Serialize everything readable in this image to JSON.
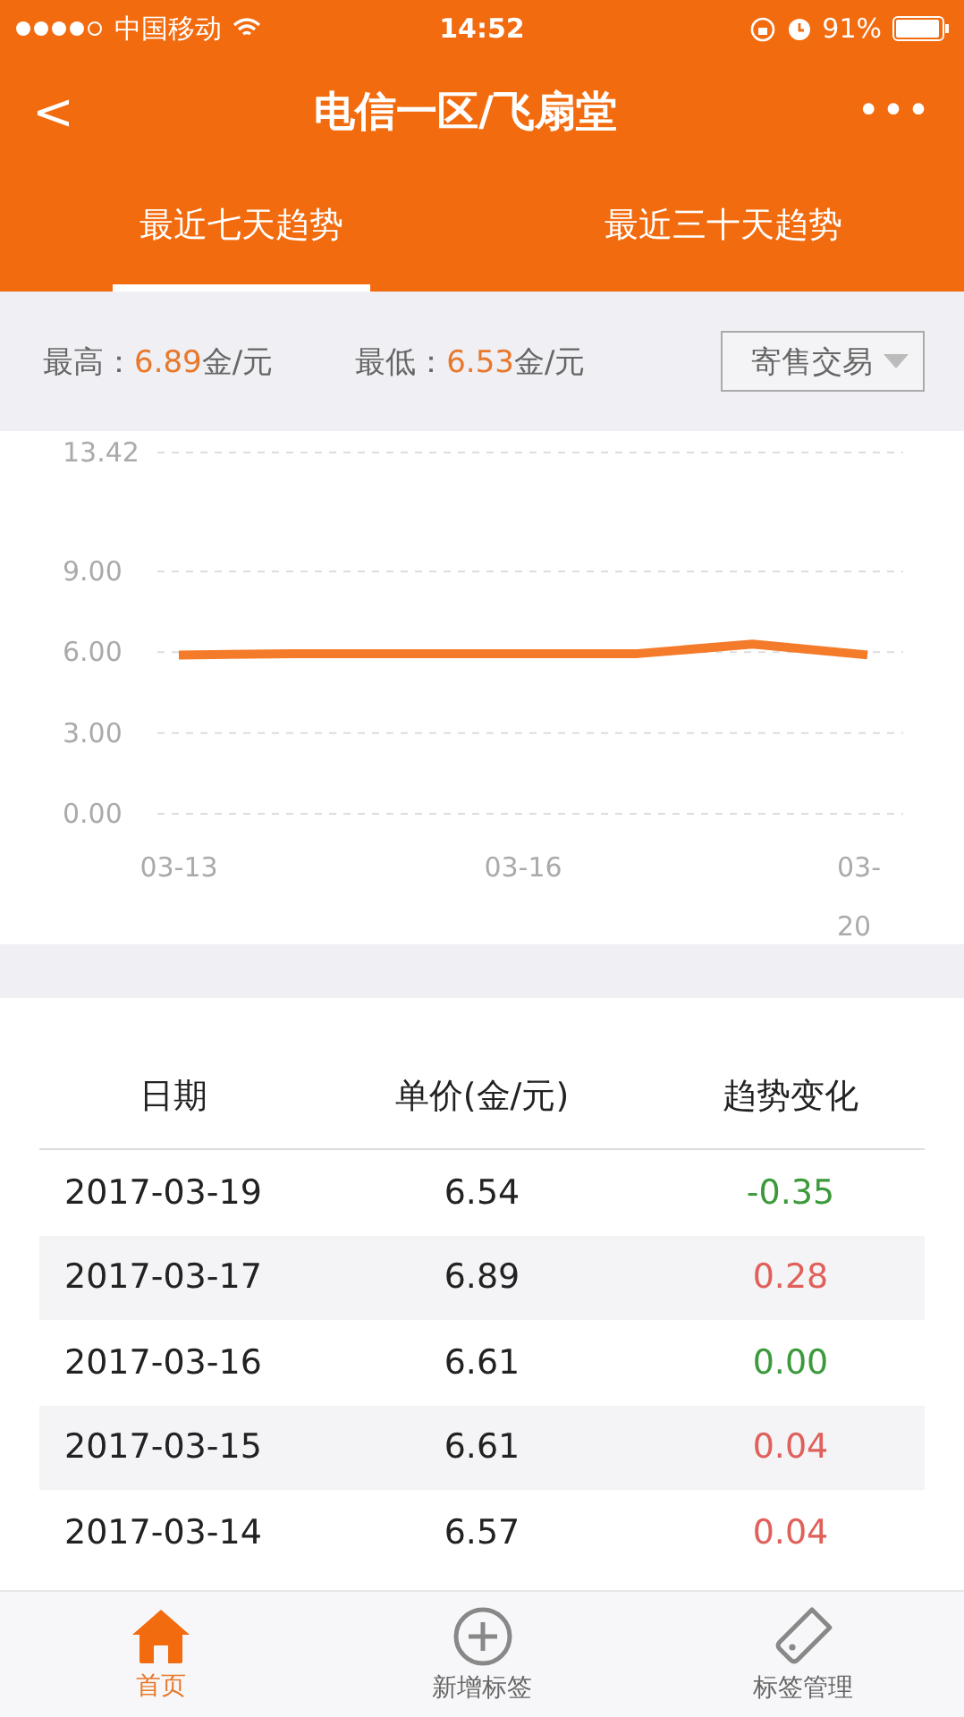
{
  "status_bar": {
    "carrier": "中国移动",
    "time": "14:52",
    "battery": "91%"
  },
  "header": {
    "back": "<",
    "title": "电信一区/飞扇堂",
    "more": "•••"
  },
  "tabs": [
    {
      "label": "最近七天趋势",
      "selected": true
    },
    {
      "label": "最近三十天趋势",
      "selected": false
    }
  ],
  "summary": {
    "high_label": "最高：",
    "high_value": "6.89",
    "high_unit": "金/元",
    "low_label": "最低：",
    "low_value": "6.53",
    "low_unit": "金/元",
    "dropdown": "寄售交易"
  },
  "chart_data": {
    "type": "line",
    "grid": true,
    "categories": [
      "03-13",
      null,
      null,
      "03-16",
      null,
      null,
      "03-20"
    ],
    "ylim": [
      0,
      13.42
    ],
    "yticks": [
      {
        "value": 0,
        "label": "0.00"
      },
      {
        "value": 3,
        "label": "3.00"
      },
      {
        "value": 6,
        "label": "6.00"
      },
      {
        "value": 9,
        "label": "9.00"
      },
      {
        "value": 13.42,
        "label": "13.42"
      }
    ],
    "series": [
      {
        "color": "#f47b2a",
        "values": [
          5.9,
          5.95,
          5.95,
          5.95,
          5.95,
          6.3,
          5.9
        ]
      }
    ]
  },
  "table": {
    "columns": [
      "日期",
      "单价(金/元)",
      "趋势变化"
    ],
    "rows": [
      {
        "date": "2017-03-19",
        "price": "6.54",
        "change": "-0.35",
        "color": "#3c9a3c"
      },
      {
        "date": "2017-03-17",
        "price": "6.89",
        "change": "0.28",
        "color": "#e0605a"
      },
      {
        "date": "2017-03-16",
        "price": "6.61",
        "change": "0.00",
        "color": "#3c9a3c"
      },
      {
        "date": "2017-03-15",
        "price": "6.61",
        "change": "0.04",
        "color": "#e0605a"
      },
      {
        "date": "2017-03-14",
        "price": "6.57",
        "change": "0.04",
        "color": "#e0605a"
      }
    ]
  },
  "tab_bar": [
    {
      "label": "首页",
      "selected": true
    },
    {
      "label": "新增标签",
      "selected": false
    },
    {
      "label": "标签管理",
      "selected": false
    }
  ]
}
